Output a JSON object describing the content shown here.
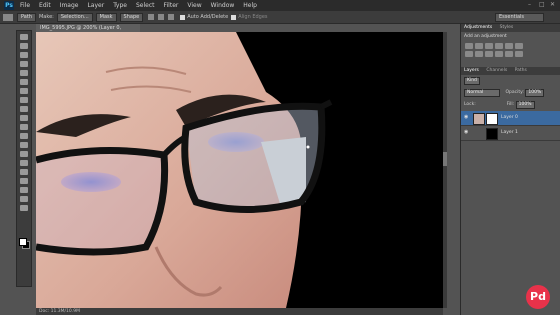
{
  "app": {
    "logo": "Ps"
  },
  "menu": [
    "File",
    "Edit",
    "Image",
    "Layer",
    "Type",
    "Select",
    "Filter",
    "View",
    "Window",
    "Help"
  ],
  "window_controls": [
    "–",
    "□",
    "✕"
  ],
  "options_bar": {
    "tool_mode": "Path",
    "make_label": "Make:",
    "buttons": [
      "Selection...",
      "Mask",
      "Shape"
    ],
    "auto_add_delete": "Auto Add/Delete",
    "align_edges": "Align Edges",
    "workspace": "Essentials"
  },
  "document": {
    "tab": "IMG_5995.JPG @ 200% (Layer 0, RGB/8) *",
    "status": "Doc: 11.3M/10.9M"
  },
  "panels": {
    "top_tabs": [
      "Adjustments",
      "Styles"
    ],
    "adjustment_subtitle": "Add an adjustment",
    "layers_tabs": [
      "Layers",
      "Channels",
      "Paths"
    ],
    "kind_label": "Kind",
    "blend_mode": "Normal",
    "opacity_label": "Opacity:",
    "opacity_value": "100%",
    "lock_label": "Lock:",
    "fill_label": "Fill:",
    "fill_value": "100%",
    "layers": [
      {
        "name": "Layer 0",
        "selected": true,
        "has_mask": true
      },
      {
        "name": "Layer 1",
        "selected": false,
        "has_mask": false
      }
    ]
  },
  "watermark": "Pd",
  "colors": {
    "selection": "#3b6aa0",
    "accent": "#e8324a",
    "ui_dark": "#3c3c3c",
    "ui_mid": "#535353"
  }
}
